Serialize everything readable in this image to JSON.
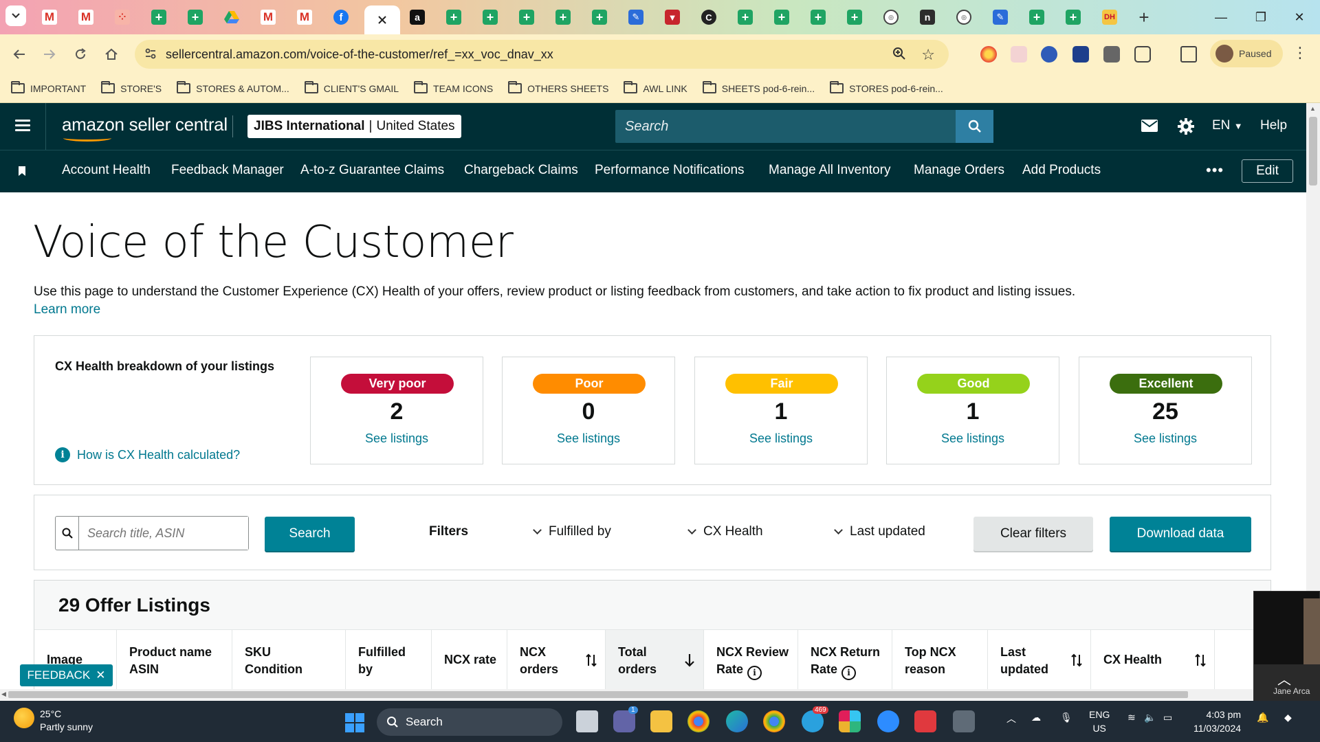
{
  "browser": {
    "url": "sellercentral.amazon.com/voice-of-the-customer/ref_=xx_voc_dnav_xx",
    "profile_status": "Paused",
    "bookmarks": [
      "IMPORTANT",
      "STORE'S",
      "STORES & AUTOM...",
      "CLIENT'S GMAIL",
      "TEAM ICONS",
      "OTHERS SHEETS",
      "AWL LINK",
      "SHEETS pod-6-rein...",
      "STORES pod-6-rein..."
    ]
  },
  "header": {
    "logo_text": "amazon seller central",
    "account_name": "JIBS International",
    "account_region": "United States",
    "search_placeholder": "Search",
    "language": "EN",
    "help": "Help"
  },
  "nav": {
    "items": [
      "Account Health",
      "Feedback Manager",
      "A-to-z Guarantee Claims",
      "Chargeback Claims",
      "Performance Notifications",
      "Manage All Inventory",
      "Manage Orders",
      "Add Products"
    ],
    "edit": "Edit"
  },
  "page": {
    "title": "Voice of the Customer",
    "description": "Use this page to understand the Customer Experience (CX) Health of your offers, review product or listing feedback from customers, and take action to fix product and listing issues.",
    "learn_more": "Learn more"
  },
  "cx_health": {
    "heading": "CX Health breakdown of your listings",
    "calc_link": "How is CX Health calculated?",
    "buckets": [
      {
        "label": "Very poor",
        "count": "2",
        "link": "See listings",
        "color": "#c40e3a"
      },
      {
        "label": "Poor",
        "count": "0",
        "link": "See listings",
        "color": "#ff8c00"
      },
      {
        "label": "Fair",
        "count": "1",
        "link": "See listings",
        "color": "#ffc000"
      },
      {
        "label": "Good",
        "count": "1",
        "link": "See listings",
        "color": "#95d21b"
      },
      {
        "label": "Excellent",
        "count": "25",
        "link": "See listings",
        "color": "#3b6e0e"
      }
    ]
  },
  "filters": {
    "search_placeholder": "Search title, ASIN",
    "search_button": "Search",
    "label": "Filters",
    "dropdowns": [
      "Fulfilled by",
      "CX Health",
      "Last updated"
    ],
    "clear": "Clear filters",
    "download": "Download data"
  },
  "table": {
    "title": "29 Offer Listings",
    "columns": [
      [
        "Image",
        ""
      ],
      [
        "Product name",
        "ASIN"
      ],
      [
        "SKU",
        "Condition"
      ],
      [
        "Fulfilled",
        "by"
      ],
      [
        "NCX rate",
        ""
      ],
      [
        "NCX",
        "orders"
      ],
      [
        "Total",
        "orders"
      ],
      [
        "NCX Review",
        "Rate"
      ],
      [
        "NCX Return",
        "Rate"
      ],
      [
        "Top NCX",
        "reason"
      ],
      [
        "Last",
        "updated"
      ],
      [
        "CX Health",
        ""
      ]
    ]
  },
  "feedback_label": "FEEDBACK",
  "video_tile_name": "Jane Arca",
  "taskbar": {
    "temperature": "25°C",
    "weather": "Partly sunny",
    "search": "Search",
    "lang_line1": "ENG",
    "lang_line2": "US",
    "time": "4:03 pm",
    "date": "11/03/2024",
    "badge_telegram": "469",
    "badge_teams": "1"
  }
}
